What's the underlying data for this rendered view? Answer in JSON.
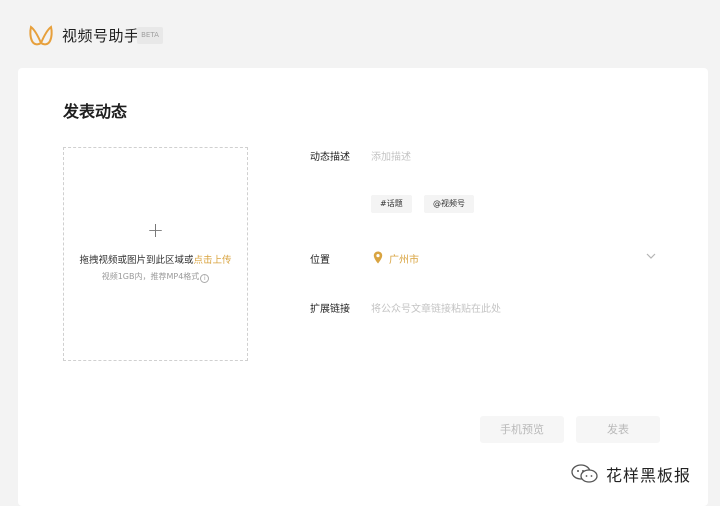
{
  "header": {
    "app_title": "视频号助手",
    "badge": "BETA",
    "logo_icon": "butterfly-logo-icon",
    "logo_color": "#e7a03c"
  },
  "main": {
    "page_title": "发表动态",
    "upload": {
      "plus_icon": "plus-icon",
      "hint_prefix": "拖拽视频或图片到此区域或",
      "hint_link": "点击上传",
      "sub_hint": "视频1GB内，推荐MP4格式",
      "info_icon": "info-icon",
      "info_glyph": "i"
    },
    "form": {
      "description": {
        "label": "动态描述",
        "placeholder": "添加描述"
      },
      "tags": [
        "#话题",
        "@视频号"
      ],
      "location": {
        "label": "位置",
        "value": "广州市",
        "pin_icon": "location-pin-icon",
        "dropdown_icon": "chevron-down-icon"
      },
      "link": {
        "label": "扩展链接",
        "placeholder": "将公众号文章链接粘贴在此处"
      }
    },
    "actions": {
      "preview_label": "手机预览",
      "publish_label": "发表"
    }
  },
  "watermark": {
    "icon": "wechat-icon",
    "text": "花样黑板报"
  },
  "colors": {
    "accent": "#d9a441",
    "background": "#f3f3f3",
    "card": "#ffffff"
  }
}
